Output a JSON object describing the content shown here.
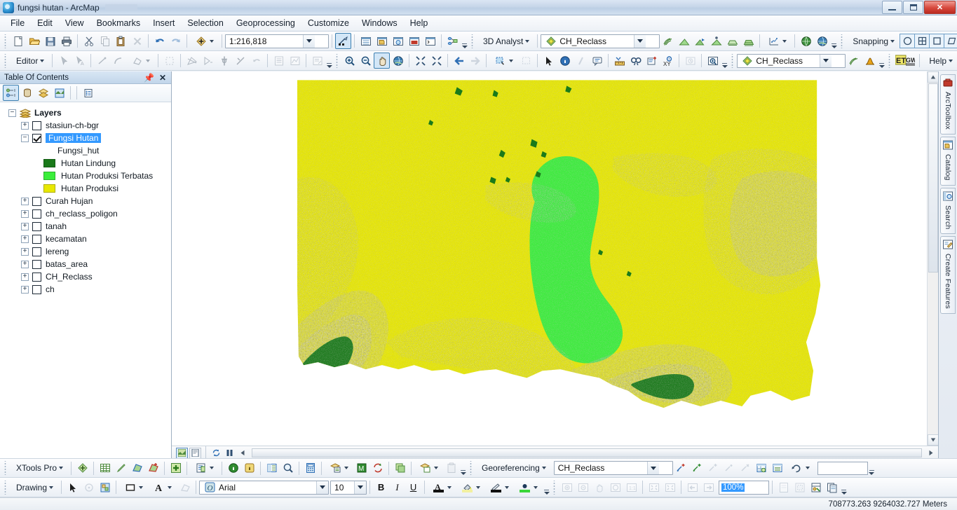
{
  "window": {
    "title": "fungsi hutan - ArcMap",
    "app_icon": "arcmap-globe-icon",
    "minimize": "minimize",
    "maximize": "restore",
    "close": "close"
  },
  "menubar": {
    "items": [
      {
        "label": "File"
      },
      {
        "label": "Edit"
      },
      {
        "label": "View"
      },
      {
        "label": "Bookmarks"
      },
      {
        "label": "Insert"
      },
      {
        "label": "Selection"
      },
      {
        "label": "Geoprocessing"
      },
      {
        "label": "Customize"
      },
      {
        "label": "Windows"
      },
      {
        "label": "Help"
      }
    ]
  },
  "standard_toolbar": {
    "scale": "1:216,818",
    "analyst_label": "3D Analyst",
    "analyst_layer": "CH_Reclass",
    "snapping_label": "Snapping"
  },
  "editor_toolbar": {
    "editor_label": "Editor",
    "layer": "CH_Reclass",
    "help_label": "Help",
    "etgw_label_1": "ET",
    "etgw_label_2": "GW"
  },
  "toc": {
    "title": "Table Of Contents",
    "pin_icon": "pin-icon",
    "close_icon": "close-icon",
    "root": "Layers",
    "items": [
      {
        "label": "stasiun-ch-bgr",
        "checked": false,
        "expander": "+",
        "type": "layer",
        "selected": false
      },
      {
        "label": "Fungsi Hutan",
        "checked": true,
        "expander": "-",
        "type": "layer",
        "selected": true
      },
      {
        "label": "Fungsi_hut",
        "type": "field"
      },
      {
        "label": "Hutan Lindung",
        "type": "legend",
        "color": "#1a7a1a"
      },
      {
        "label": "Hutan Produksi Terbatas",
        "type": "legend",
        "color": "#3aee3a"
      },
      {
        "label": "Hutan Produksi",
        "type": "legend",
        "color": "#e8e800"
      },
      {
        "label": "Curah Hujan",
        "checked": false,
        "expander": "+",
        "type": "layer",
        "selected": false
      },
      {
        "label": "ch_reclass_poligon",
        "checked": false,
        "expander": "+",
        "type": "layer",
        "selected": false
      },
      {
        "label": "tanah",
        "checked": false,
        "expander": "+",
        "type": "layer",
        "selected": false
      },
      {
        "label": "kecamatan",
        "checked": false,
        "expander": "+",
        "type": "layer",
        "selected": false
      },
      {
        "label": "lereng",
        "checked": false,
        "expander": "+",
        "type": "layer",
        "selected": false
      },
      {
        "label": "batas_area",
        "checked": false,
        "expander": "+",
        "type": "layer",
        "selected": false
      },
      {
        "label": "CH_Reclass",
        "checked": false,
        "expander": "+",
        "type": "layer",
        "selected": false
      },
      {
        "label": "ch",
        "checked": false,
        "expander": "+",
        "type": "layer",
        "selected": false
      }
    ]
  },
  "dock_tabs": [
    {
      "label": "ArcToolbox",
      "icon": "arctoolbox-icon"
    },
    {
      "label": "Catalog",
      "icon": "catalog-icon"
    },
    {
      "label": "Search",
      "icon": "search-icon"
    },
    {
      "label": "Create Features",
      "icon": "create-features-icon"
    }
  ],
  "map": {
    "colors": {
      "hutan_produksi": "#e8e800",
      "hutan_produksi_terbatas": "#3aee3a",
      "hutan_lindung": "#1a7a1a",
      "background": "#ffffff"
    }
  },
  "xtools_toolbar": {
    "label": "XTools Pro"
  },
  "georef_toolbar": {
    "label": "Georeferencing",
    "layer": "CH_Reclass",
    "text_value": "",
    "text_placeholder": ""
  },
  "drawing_toolbar": {
    "label": "Drawing",
    "font": "Arial",
    "font_size": "10",
    "bold": "B",
    "italic": "I",
    "underline": "U",
    "zoom_value": "100%"
  },
  "statusbar": {
    "coordinates": "708773.263  9264032.727 Meters"
  }
}
